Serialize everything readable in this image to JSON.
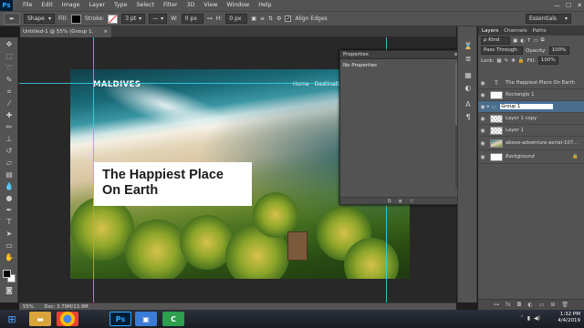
{
  "app": {
    "logo": "Ps"
  },
  "menu": [
    "File",
    "Edit",
    "Image",
    "Layer",
    "Type",
    "Select",
    "Filter",
    "3D",
    "View",
    "Window",
    "Help"
  ],
  "window_controls": {
    "minimize": "—",
    "maximize": "☐",
    "close": "✕"
  },
  "options": {
    "mode": "Shape",
    "fill_label": "Fill:",
    "stroke_label": "Stroke:",
    "stroke_width": "3 pt",
    "w_label": "W:",
    "w_value": "0 px",
    "h_label": "H:",
    "h_value": "0 px",
    "align_edges_label": "Align Edges",
    "workspace": "Essentials"
  },
  "document_tab": {
    "title": "Untitled-1 @ 55% (Group 1, RGB/8) *",
    "close": "×"
  },
  "artwork": {
    "brand": "MALDIVES",
    "nav": [
      "Home",
      "Destination"
    ],
    "hero_title_line1": "The Happiest Place",
    "hero_title_line2": "On Earth"
  },
  "properties_panel": {
    "title": "Properties",
    "body": "No Properties"
  },
  "status_bar": {
    "zoom": "55%",
    "doc": "Doc: 3.79M/13.9M"
  },
  "layers_panel": {
    "tabs": [
      "Layers",
      "Channels",
      "Paths"
    ],
    "filter": "ρ Kind",
    "blend_mode": "Pass Through",
    "opacity_label": "Opacity:",
    "opacity": "100%",
    "lock_label": "Lock:",
    "fill_label": "Fill:",
    "fill": "100%",
    "layers": [
      {
        "name": "The Happiest Place On Earth",
        "kind": "text"
      },
      {
        "name": "Rectangle 1",
        "kind": "shape"
      },
      {
        "name": "Group 1",
        "kind": "group",
        "selected": true
      },
      {
        "name": "Layer 1 copy",
        "kind": "layer"
      },
      {
        "name": "Layer 1",
        "kind": "layer"
      },
      {
        "name": "above-adventure-aerial-107...",
        "kind": "photo"
      },
      {
        "name": "Background",
        "kind": "background"
      }
    ],
    "footer_icons": [
      "link-icon",
      "fx-icon",
      "mask-icon",
      "adjustment-icon",
      "folder-icon",
      "new-layer-icon",
      "trash-icon"
    ]
  },
  "taskbar": {
    "apps": [
      "folder",
      "chrome",
      "photoshop",
      "explorer",
      "camtasia"
    ],
    "time": "1:32 PM",
    "date": "4/4/2019"
  },
  "colors": {
    "accent": "#34d0e0",
    "panel": "#535353",
    "selection": "#4b6d8c"
  }
}
